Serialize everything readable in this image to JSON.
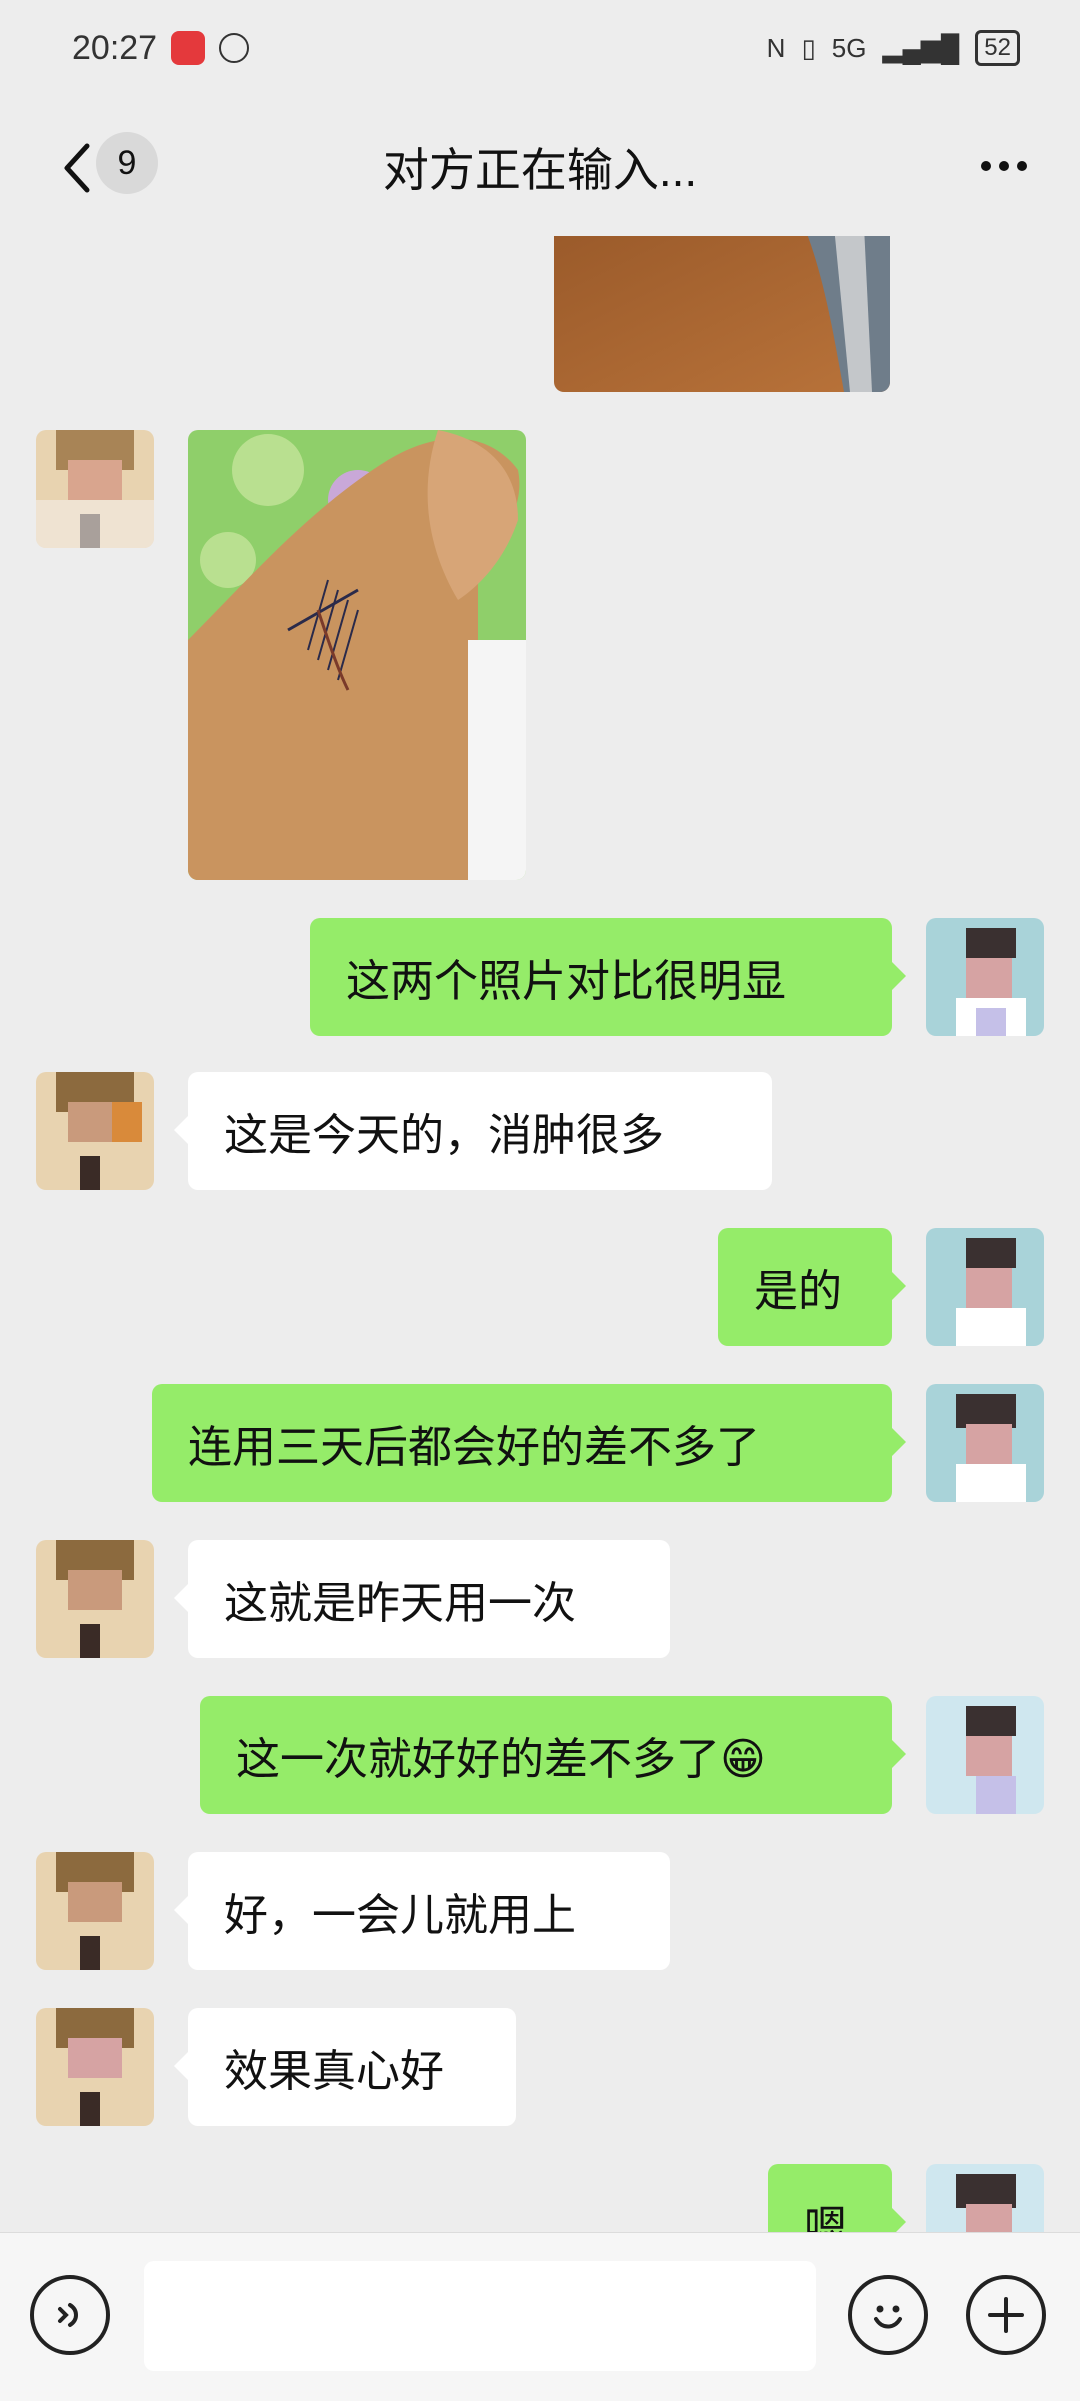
{
  "status": {
    "time": "20:27",
    "network": "5G",
    "battery": "52"
  },
  "nav": {
    "unread_count": "9",
    "title": "对方正在输入..."
  },
  "messages": [
    {
      "side": "in",
      "text": "这是今天的，消肿很多"
    },
    {
      "side": "out",
      "text": "这两个照片对比很明显"
    },
    {
      "side": "out",
      "text": "是的"
    },
    {
      "side": "out",
      "text": "连用三天后都会好的差不多了"
    },
    {
      "side": "in",
      "text": "这就是昨天用一次"
    },
    {
      "side": "out",
      "text": "这一次就好好的差不多了😁"
    },
    {
      "side": "in",
      "text": "好，一会儿就用上"
    },
    {
      "side": "in",
      "text": "效果真心好"
    },
    {
      "side": "out",
      "text": "嗯"
    }
  ],
  "input": {
    "placeholder": ""
  },
  "icons": [
    "back-icon",
    "more-icon",
    "voice-icon",
    "emoji-icon",
    "plus-icon"
  ],
  "colors": {
    "outgoing_bubble": "#95ec69",
    "incoming_bubble": "#ffffff",
    "background": "#ededed"
  }
}
